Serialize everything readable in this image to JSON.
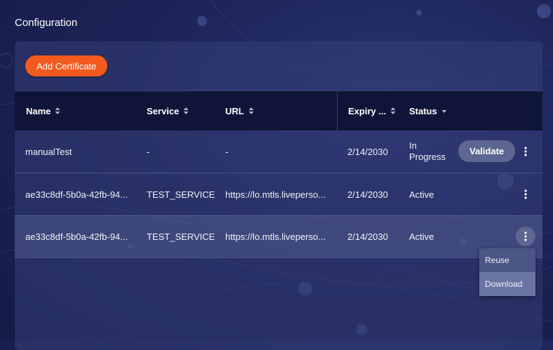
{
  "page": {
    "title": "Configuration"
  },
  "toolbar": {
    "add_label": "Add Certificate"
  },
  "table": {
    "columns": [
      {
        "label": "Name",
        "sort": "both"
      },
      {
        "label": "Service",
        "sort": "both"
      },
      {
        "label": "URL",
        "sort": "both"
      },
      {
        "label": "Expiry ...",
        "sort": "both"
      },
      {
        "label": "Status",
        "sort": "desc"
      }
    ],
    "rows": [
      {
        "name": "manualTest",
        "service": "-",
        "url": "-",
        "expiry": "2/14/2030",
        "status_line1": "In",
        "status_line2": "Progress",
        "action": "Validate"
      },
      {
        "name": "ae33c8df-5b0a-42fb-94...",
        "service": "TEST_SERVICE",
        "url": "https://lo.mtls.liveperso...",
        "expiry": "2/14/2030",
        "status": "Active"
      },
      {
        "name": "ae33c8df-5b0a-42fb-94...",
        "service": "TEST_SERVICE",
        "url": "https://lo.mtls.liveperso...",
        "expiry": "2/14/2030",
        "status": "Active"
      }
    ]
  },
  "menu": {
    "items": [
      "Reuse",
      "Download"
    ]
  },
  "colors": {
    "accent": "#f25a1f",
    "header_bg": "#0f1538",
    "panel_bg": "#343e76",
    "menu_bg": "#4c5686"
  },
  "icons": {
    "sort": "sort-both-icon",
    "sort_desc": "sort-desc-icon",
    "more": "more-vertical-icon"
  }
}
